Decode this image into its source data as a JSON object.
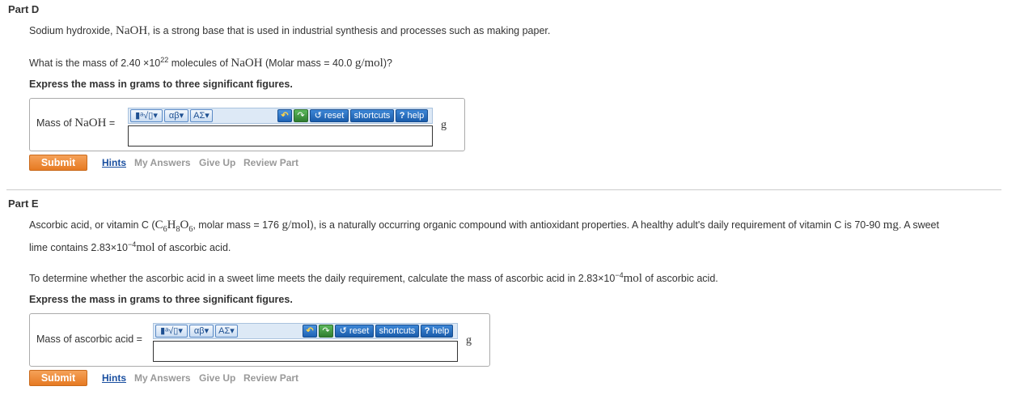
{
  "part_d": {
    "title": "Part D",
    "intro_before": "Sodium hydroxide, ",
    "intro_formula": "NaOH",
    "intro_after": ", is a strong base that is used in industrial synthesis and processes such as making paper.",
    "question_before": "What is the mass of 2.40 ×10",
    "question_exp": "22",
    "question_mid": " molecules of ",
    "question_formula": "NaOH",
    "question_mid2": " (Molar mass = 40.0 ",
    "question_unit": "g/mol",
    "question_after": ")?",
    "instruction": "Express the mass in grams to three significant figures.",
    "answer_label_prefix": "Mass of ",
    "answer_label_formula": "NaOH",
    "answer_label_suffix": " =",
    "answer_value": "",
    "unit": "g"
  },
  "part_e": {
    "title": "Part E",
    "intro_line1_before": "Ascorbic acid, or vitamin C (",
    "intro_line1_formula_C": "C",
    "intro_line1_sub1": "6",
    "intro_line1_formula_H": "H",
    "intro_line1_sub2": "8",
    "intro_line1_formula_O": "O",
    "intro_line1_sub3": "6",
    "intro_line1_mid": ", molar mass = 176 ",
    "intro_line1_unit": "g/mol",
    "intro_line1_after": "), is a naturally occurring organic compound with antioxidant properties. A healthy adult's daily requirement of vitamin C is 70-90 ",
    "intro_line1_unit2": "mg",
    "intro_line1_end": ". A sweet",
    "intro_line2_before": "lime contains 2.83×10",
    "intro_line2_exp": "−4",
    "intro_line2_unit": "mol",
    "intro_line2_after": " of ascorbic acid.",
    "question_before": "To determine whether the ascorbic acid in a sweet lime meets the daily requirement, calculate the mass of ascorbic acid in 2.83×10",
    "question_exp": "−4",
    "question_unit": "mol",
    "question_after": " of ascorbic acid.",
    "instruction": "Express the mass in grams to three significant figures.",
    "answer_label": "Mass of ascorbic acid =",
    "answer_value": "",
    "unit": "g"
  },
  "toolbar": {
    "templates_label": "▮ᵃ√▯",
    "greek_lower_label": "αβ",
    "greek_upper_label": "ΑΣ",
    "undo_label": "↶",
    "redo_label": "↷",
    "reset_label": "reset",
    "shortcuts_label": "shortcuts",
    "help_label": "help",
    "help_mark": "?",
    "reset_mark": "↺"
  },
  "actions": {
    "submit": "Submit",
    "hints": "Hints",
    "my_answers": "My Answers",
    "give_up": "Give Up",
    "review_part": "Review Part"
  },
  "icons": {
    "undo": "undo-icon",
    "redo": "redo-icon",
    "reset": "reset-icon",
    "help": "help-icon",
    "dropdown": "chevron-down-icon"
  },
  "colors": {
    "submit": "#e67a22",
    "toolbar_bg": "#dde9f6",
    "toolbar_button": "#1a5cab",
    "link_active": "#1a4fa0",
    "link_disabled": "#999999"
  }
}
